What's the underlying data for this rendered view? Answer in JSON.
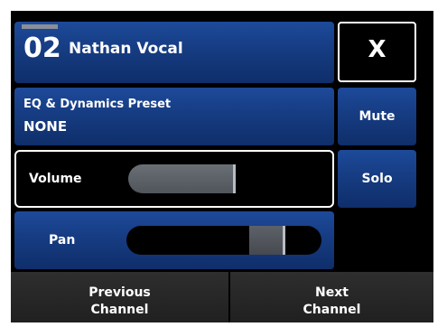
{
  "channel": {
    "number": "02",
    "name": "Nathan Vocal"
  },
  "close_button": {
    "label": "X"
  },
  "eq_preset": {
    "title": "EQ & Dynamics Preset",
    "value": "NONE"
  },
  "mute_button": {
    "label": "Mute"
  },
  "solo_button": {
    "label": "Solo"
  },
  "volume": {
    "label": "Volume",
    "level_fraction": 0.55
  },
  "pan": {
    "label": "Pan",
    "position_fraction": 0.72
  },
  "previous_button": {
    "line1": "Previous",
    "line2": "Channel"
  },
  "next_button": {
    "line1": "Next",
    "line2": "Channel"
  },
  "colors": {
    "accent_blue": "#163c82",
    "background": "#000000",
    "text": "#ffffff"
  }
}
